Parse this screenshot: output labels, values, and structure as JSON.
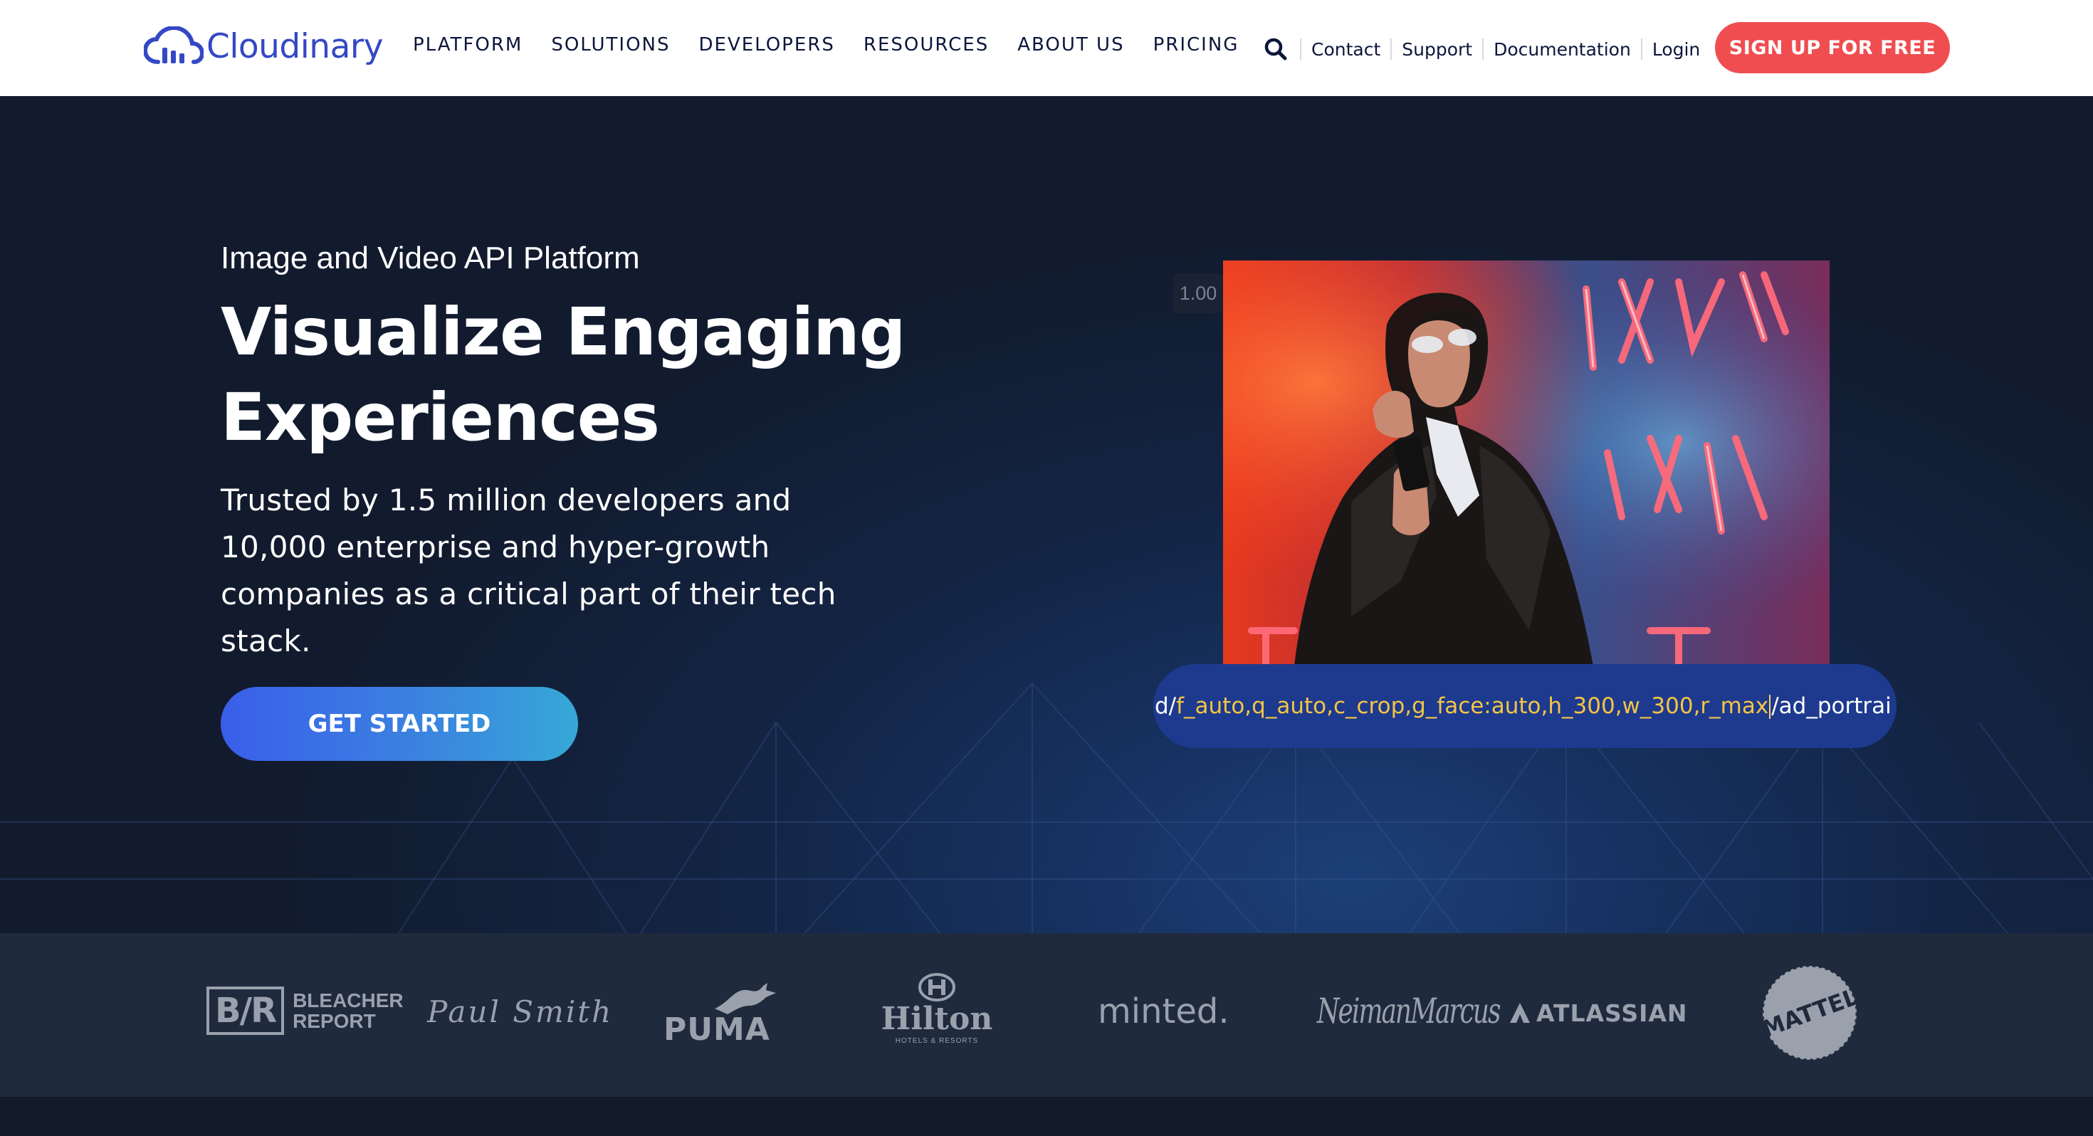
{
  "header": {
    "logo_text": "Cloudinary",
    "nav": [
      "PLATFORM",
      "SOLUTIONS",
      "DEVELOPERS",
      "RESOURCES",
      "ABOUT US",
      "PRICING"
    ],
    "utility_links": [
      "Contact",
      "Support",
      "Documentation",
      "Login"
    ],
    "search_icon": "search-icon",
    "signup_label": "SIGN UP FOR FREE"
  },
  "hero": {
    "eyebrow": "Image and Video API Platform",
    "headline_line1": "Visualize Engaging",
    "headline_line2": "Experiences",
    "subhead": "Trusted by 1.5 million developers and 10,000 enterprise and hyper-growth companies as a critical part of their tech stack.",
    "cta_label": "GET STARTED",
    "zoom_badge": "1.00",
    "url": {
      "prefix": "d/",
      "params": "f_auto,q_auto,c_crop,g_face:auto,h_300,w_300,r_max",
      "suffix": "/ad_portrai"
    }
  },
  "logos": {
    "bleacher_mark": "B/R",
    "bleacher_text1": "BLEACHER",
    "bleacher_text2": "REPORT",
    "paulsmith": "Paul Smith",
    "puma": "PUMA",
    "hilton": "Hilton",
    "hilton_sub": "HOTELS & RESORTS",
    "minted": "minted.",
    "neiman": "NeimanMarcus",
    "atlassian": "ATLASSIAN",
    "mattel": "MATTEL"
  },
  "colors": {
    "brand_blue": "#3448c5",
    "signup_red": "#f04d51",
    "hero_bg": "#141d2e",
    "url_param_yellow": "#f5c544",
    "logo_gray": "#9aa1ad"
  }
}
